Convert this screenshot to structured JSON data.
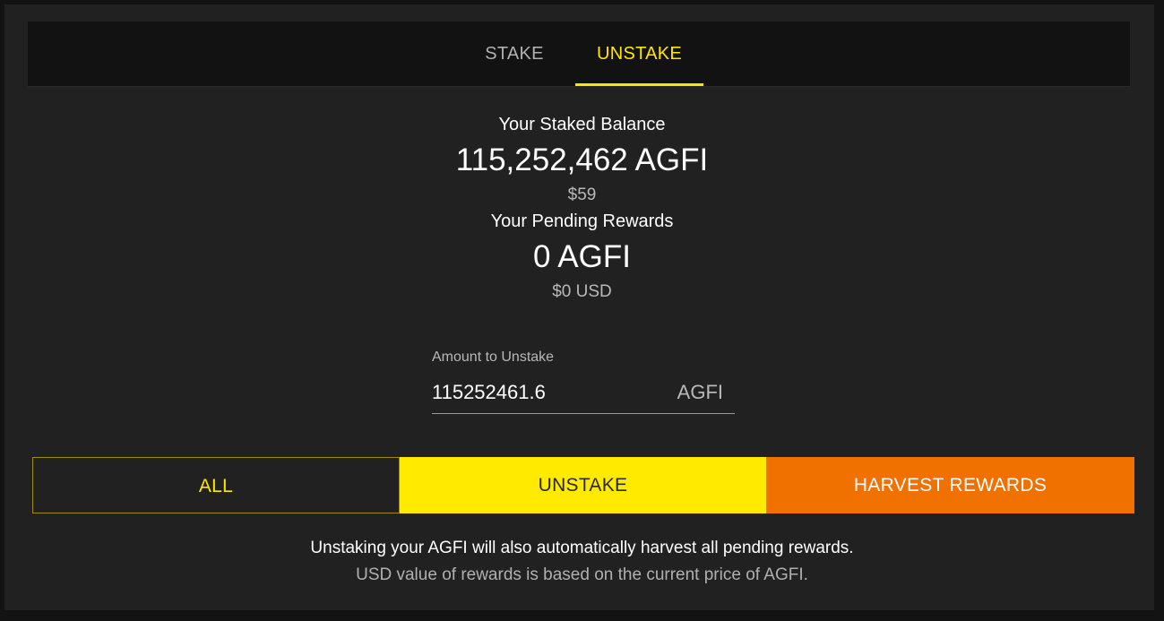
{
  "tabs": {
    "stake_label": "STAKE",
    "unstake_label": "UNSTAKE",
    "active": "UNSTAKE"
  },
  "balance": {
    "staked_label": "Your Staked Balance",
    "staked_amount": "115,252,462 AGFI",
    "staked_usd": "$59",
    "pending_label": "Your Pending Rewards",
    "pending_amount": "0 AGFI",
    "pending_usd": "$0 USD"
  },
  "unstake_input": {
    "label": "Amount to Unstake",
    "value": "115252461.6",
    "unit": "AGFI"
  },
  "actions": {
    "all_label": "ALL",
    "unstake_label": "UNSTAKE",
    "harvest_label": "HARVEST REWARDS"
  },
  "notes": {
    "line1": "Unstaking your AGFI will also automatically harvest all pending rewards.",
    "line2": "USD value of rewards is based on the current price of AGFI."
  },
  "colors": {
    "accent": "#ffe600",
    "harvest": "#f07000",
    "background": "#212121",
    "tabbar": "#121212"
  }
}
